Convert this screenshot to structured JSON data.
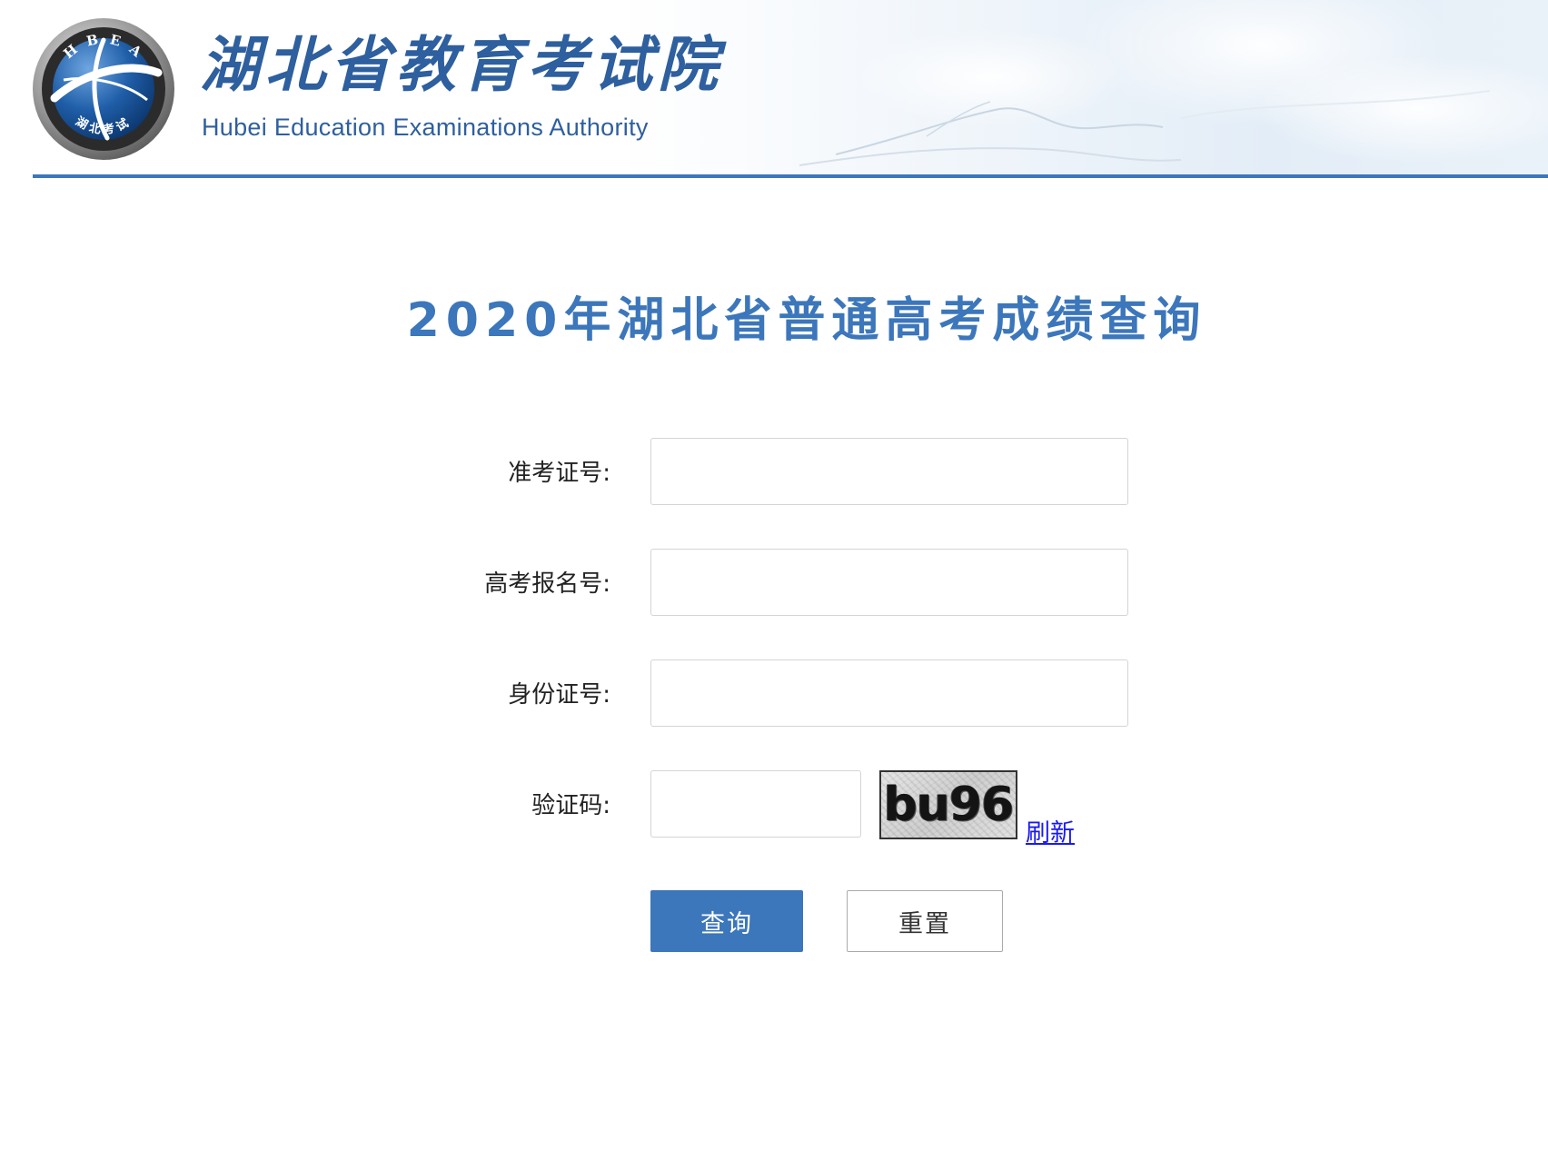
{
  "header": {
    "logo_ring_text": "H B E A",
    "logo_bottom_text": "湖北考试",
    "title_cn": "湖北省教育考试院",
    "title_en": "Hubei Education Examinations Authority"
  },
  "page_title": "2020年湖北省普通高考成绩查询",
  "form": {
    "fields": [
      {
        "label": "准考证号:",
        "value": "",
        "placeholder": ""
      },
      {
        "label": "高考报名号:",
        "value": "",
        "placeholder": ""
      },
      {
        "label": "身份证号:",
        "value": "",
        "placeholder": ""
      },
      {
        "label": "验证码:",
        "value": "",
        "placeholder": ""
      }
    ],
    "captcha_code": "bu96",
    "refresh_label": "刷新",
    "submit_label": "查询",
    "reset_label": "重置"
  },
  "colors": {
    "brand_blue": "#3c76bb",
    "link_blue": "#1a1aee"
  }
}
